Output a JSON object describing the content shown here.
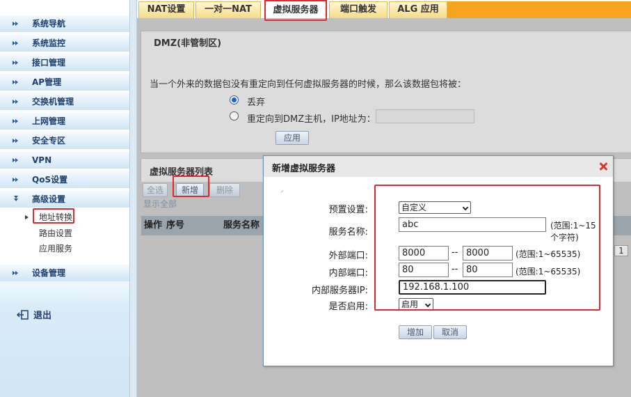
{
  "tabs": [
    {
      "label": "NAT设置"
    },
    {
      "label": "一对一NAT"
    },
    {
      "label": "虚拟服务器"
    },
    {
      "label": "端口触发"
    },
    {
      "label": "ALG 应用"
    }
  ],
  "sidebar": {
    "items": [
      {
        "label": "系统导航"
      },
      {
        "label": "系统监控"
      },
      {
        "label": "接口管理"
      },
      {
        "label": "AP管理"
      },
      {
        "label": "交换机管理"
      },
      {
        "label": "上网管理"
      },
      {
        "label": "安全专区"
      },
      {
        "label": "VPN"
      },
      {
        "label": "QoS设置"
      },
      {
        "label": "高级设置"
      },
      {
        "label": "设备管理"
      }
    ],
    "subitems": [
      {
        "label": "地址转换"
      },
      {
        "label": "路由设置"
      },
      {
        "label": "应用服务"
      }
    ],
    "logout": "退出"
  },
  "dmz": {
    "title": "DMZ(非管制区)",
    "description": "当一个外来的数据包没有重定向到任何虚拟服务器的时候，那么该数据包将被：",
    "option_drop": "丢弃",
    "option_redirect": "重定向到DMZ主机，IP地址为：",
    "selected": "丢弃",
    "apply_label": "应用"
  },
  "list": {
    "title": "虚拟服务器列表",
    "select_all": "全选",
    "add": "新增",
    "delete": "删除",
    "show_all": "显示全部",
    "columns": [
      "操作",
      "序号",
      "服务名称"
    ],
    "page": "1"
  },
  "modal": {
    "title": "新增虚拟服务器",
    "preset_label": "预置设置:",
    "preset_value": "自定义",
    "name_label": "服务名称:",
    "name_value": "abc",
    "name_hint_1": "(范围:1~15",
    "name_hint_2": "个字符)",
    "ext_port_label": "外部端口:",
    "ext_port_from": "8000",
    "ext_port_to": "8000",
    "port_hint": "(范围:1~65535)",
    "int_port_label": "内部端口:",
    "int_port_from": "80",
    "int_port_to": "80",
    "ip_label": "内部服务器IP:",
    "ip_value": "192.168.1.100",
    "enable_label": "是否启用:",
    "enable_value": "启用",
    "dash": "--",
    "add_label": "增加",
    "cancel_label": "取消"
  },
  "colors": {
    "highlight": "#e0282e",
    "tab_accent": "#f6a31e",
    "sidebar_text": "#1f3f6e"
  }
}
